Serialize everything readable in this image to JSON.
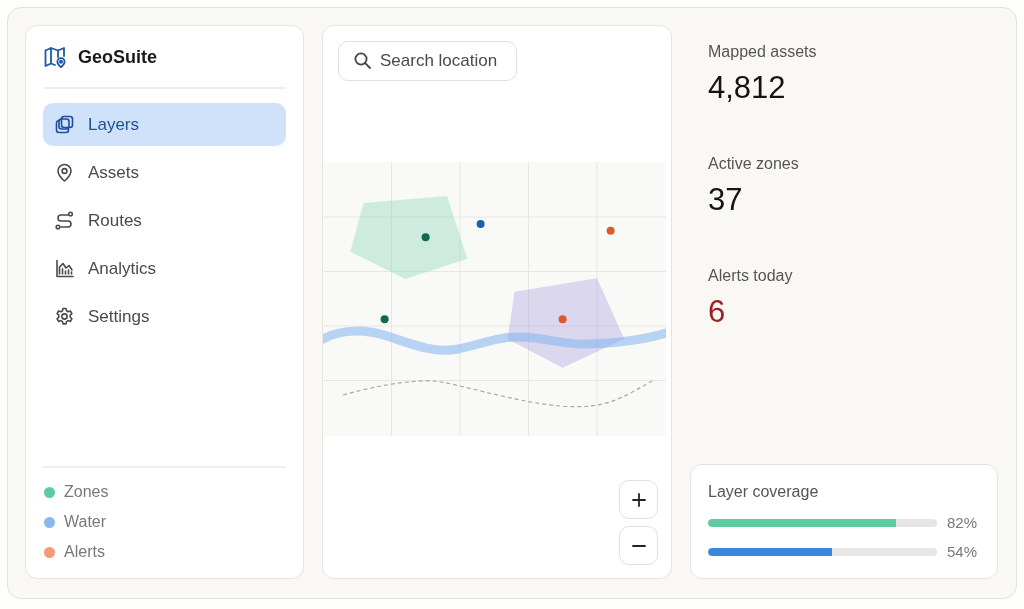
{
  "brand": {
    "name": "GeoSuite"
  },
  "nav": [
    {
      "label": "Layers",
      "selected": true
    },
    {
      "label": "Assets",
      "selected": false
    },
    {
      "label": "Routes",
      "selected": false
    },
    {
      "label": "Analytics",
      "selected": false
    },
    {
      "label": "Settings",
      "selected": false
    }
  ],
  "legend": [
    {
      "label": "Zones",
      "color": "#5ecba1"
    },
    {
      "label": "Water",
      "color": "#8ab8ee"
    },
    {
      "label": "Alerts",
      "color": "#f39a77"
    }
  ],
  "map": {
    "search": {
      "placeholder": "Search location"
    }
  },
  "stats": [
    {
      "label": "Mapped assets",
      "value": "4,812",
      "kind": "count"
    },
    {
      "label": "Active zones",
      "value": "37",
      "kind": "count"
    },
    {
      "label": "Alerts today",
      "value": "6",
      "kind": "alert"
    }
  ],
  "coverage": {
    "title": "Layer coverage",
    "bars": [
      {
        "level": 0.82,
        "reading": "82%",
        "color": "#5ecba1"
      },
      {
        "level": 0.54,
        "reading": "54%",
        "color": "#3a87dc"
      }
    ]
  }
}
